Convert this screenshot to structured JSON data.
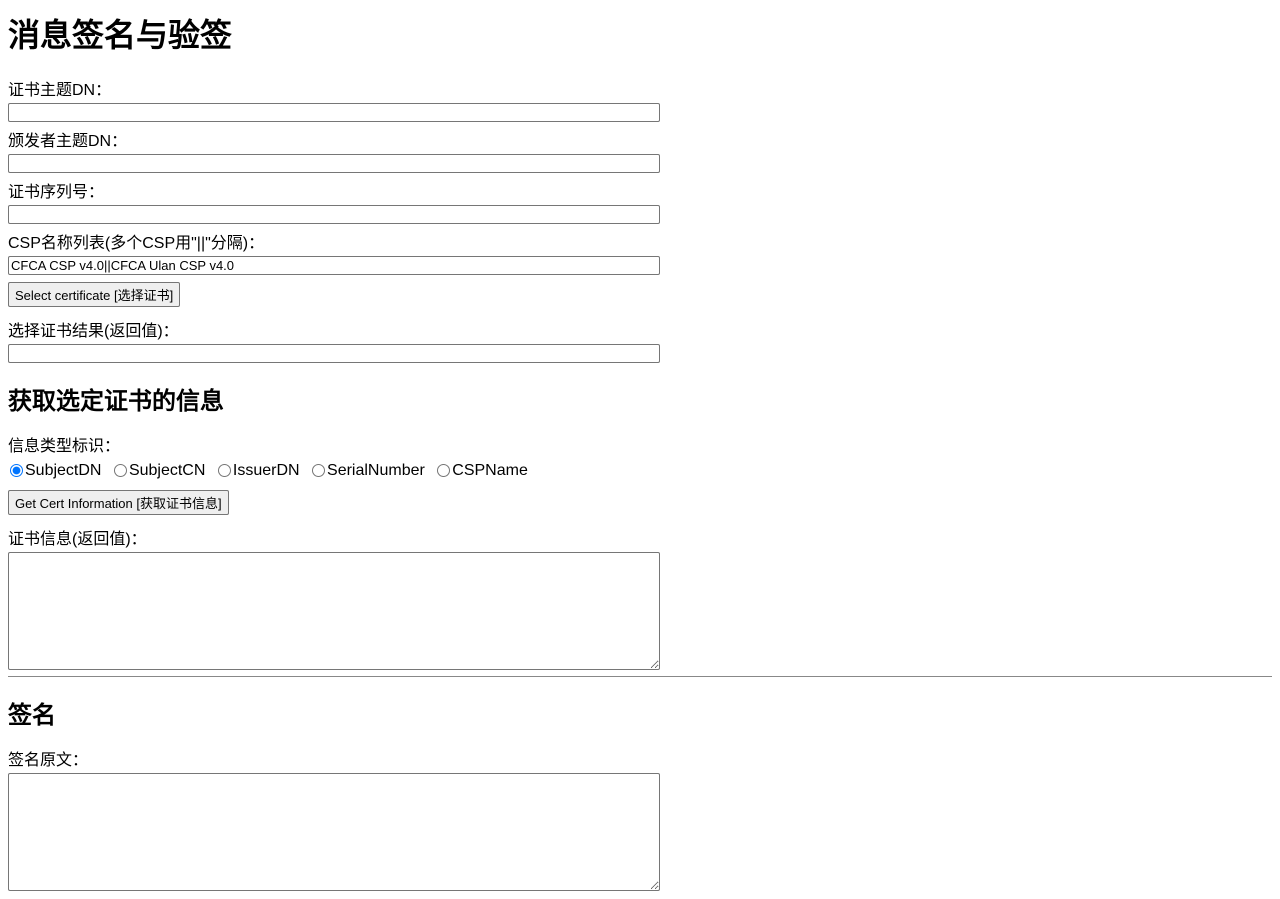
{
  "page": {
    "title": "消息签名与验签"
  },
  "section1": {
    "label_subjectdn": "证书主题DN：",
    "value_subjectdn": "",
    "label_issuerdn": "颁发者主题DN：",
    "value_issuerdn": "",
    "label_serial": "证书序列号：",
    "value_serial": "",
    "label_csplist": "CSP名称列表(多个CSP用\"||\"分隔)：",
    "value_csplist": "CFCA CSP v4.0||CFCA Ulan CSP v4.0",
    "button_select": "Select certificate [选择证书]",
    "label_selectresult": "选择证书结果(返回值)：",
    "value_selectresult": ""
  },
  "section2": {
    "heading": "获取选定证书的信息",
    "label_infotype": "信息类型标识：",
    "radio_subjectdn": "SubjectDN",
    "radio_subjectcn": "SubjectCN",
    "radio_issuerdn": "IssuerDN",
    "radio_serialnumber": "SerialNumber",
    "radio_cspname": "CSPName",
    "button_getinfo": "Get Cert Information [获取证书信息]",
    "label_certinfo": "证书信息(返回值)：",
    "value_certinfo": ""
  },
  "section3": {
    "heading": "签名",
    "label_source": "签名原文：",
    "value_source": ""
  }
}
